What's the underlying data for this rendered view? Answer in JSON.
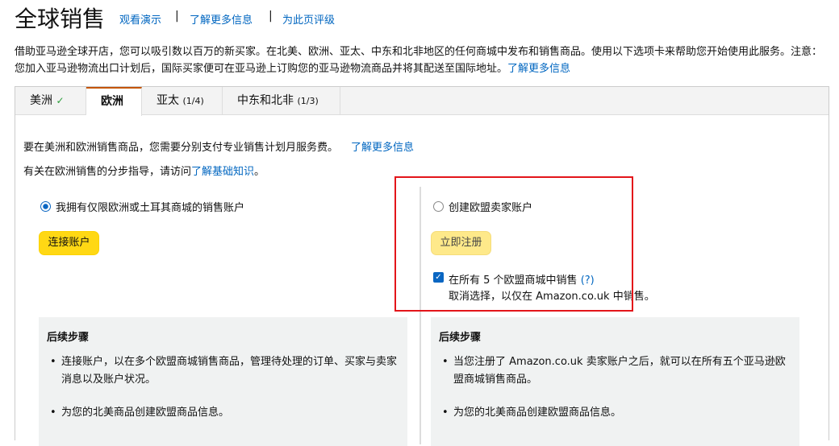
{
  "header": {
    "title": "全球销售",
    "links": [
      "观看演示",
      "了解更多信息",
      "为此页评级"
    ],
    "separator": "|"
  },
  "intro": {
    "text": "借助亚马逊全球开店，您可以吸引数以百万的新买家。在北美、欧洲、亚太、中东和北非地区的任何商城中发布和销售商品。使用以下选项卡来帮助您开始使用此服务。注意： 您加入亚马逊物流出口计划后，国际买家便可在亚马逊上订购您的亚马逊物流商品并将其配送至国际地址。",
    "link": "了解更多信息"
  },
  "tabs": [
    {
      "label": "美洲",
      "badge": "✓"
    },
    {
      "label": "欧洲",
      "badge": ""
    },
    {
      "label": "亚太",
      "badge": "(1/4)"
    },
    {
      "label": "中东和北非",
      "badge": "(1/3)"
    }
  ],
  "content": {
    "fee_note": "要在美洲和欧洲销售商品，您需要分别支付专业销售计划月服务费。",
    "fee_link": "了解更多信息",
    "guide_text": "有关在欧洲销售的分步指导，请访问",
    "guide_link": "了解基础知识",
    "guide_end": "。",
    "left": {
      "radio_label": "我拥有仅限欧洲或土耳其商城的销售账户",
      "button": "连接账户",
      "next_title": "后续步骤",
      "steps": [
        "连接账户，以在多个欧盟商城销售商品，管理待处理的订单、买家与卖家消息以及账户状况。",
        "为您的北美商品创建欧盟商品信息。"
      ]
    },
    "right": {
      "radio_label": "创建欧盟卖家账户",
      "button": "立即注册",
      "checkbox_label": "在所有 5 个欧盟商城中销售",
      "help": "(?)",
      "checkbox_sub": "取消选择，以仅在 Amazon.co.uk 中销售。",
      "next_title": "后续步骤",
      "steps": [
        "当您注册了 Amazon.co.uk 卖家账户之后，就可以在所有五个亚马逊欧盟商城销售商品。",
        "为您的北美商品创建欧盟商品信息。"
      ]
    }
  },
  "colors": {
    "accent": "#c45500",
    "link": "#0066c0",
    "highlight_box": "#e3151a",
    "button": "#ffd814"
  }
}
